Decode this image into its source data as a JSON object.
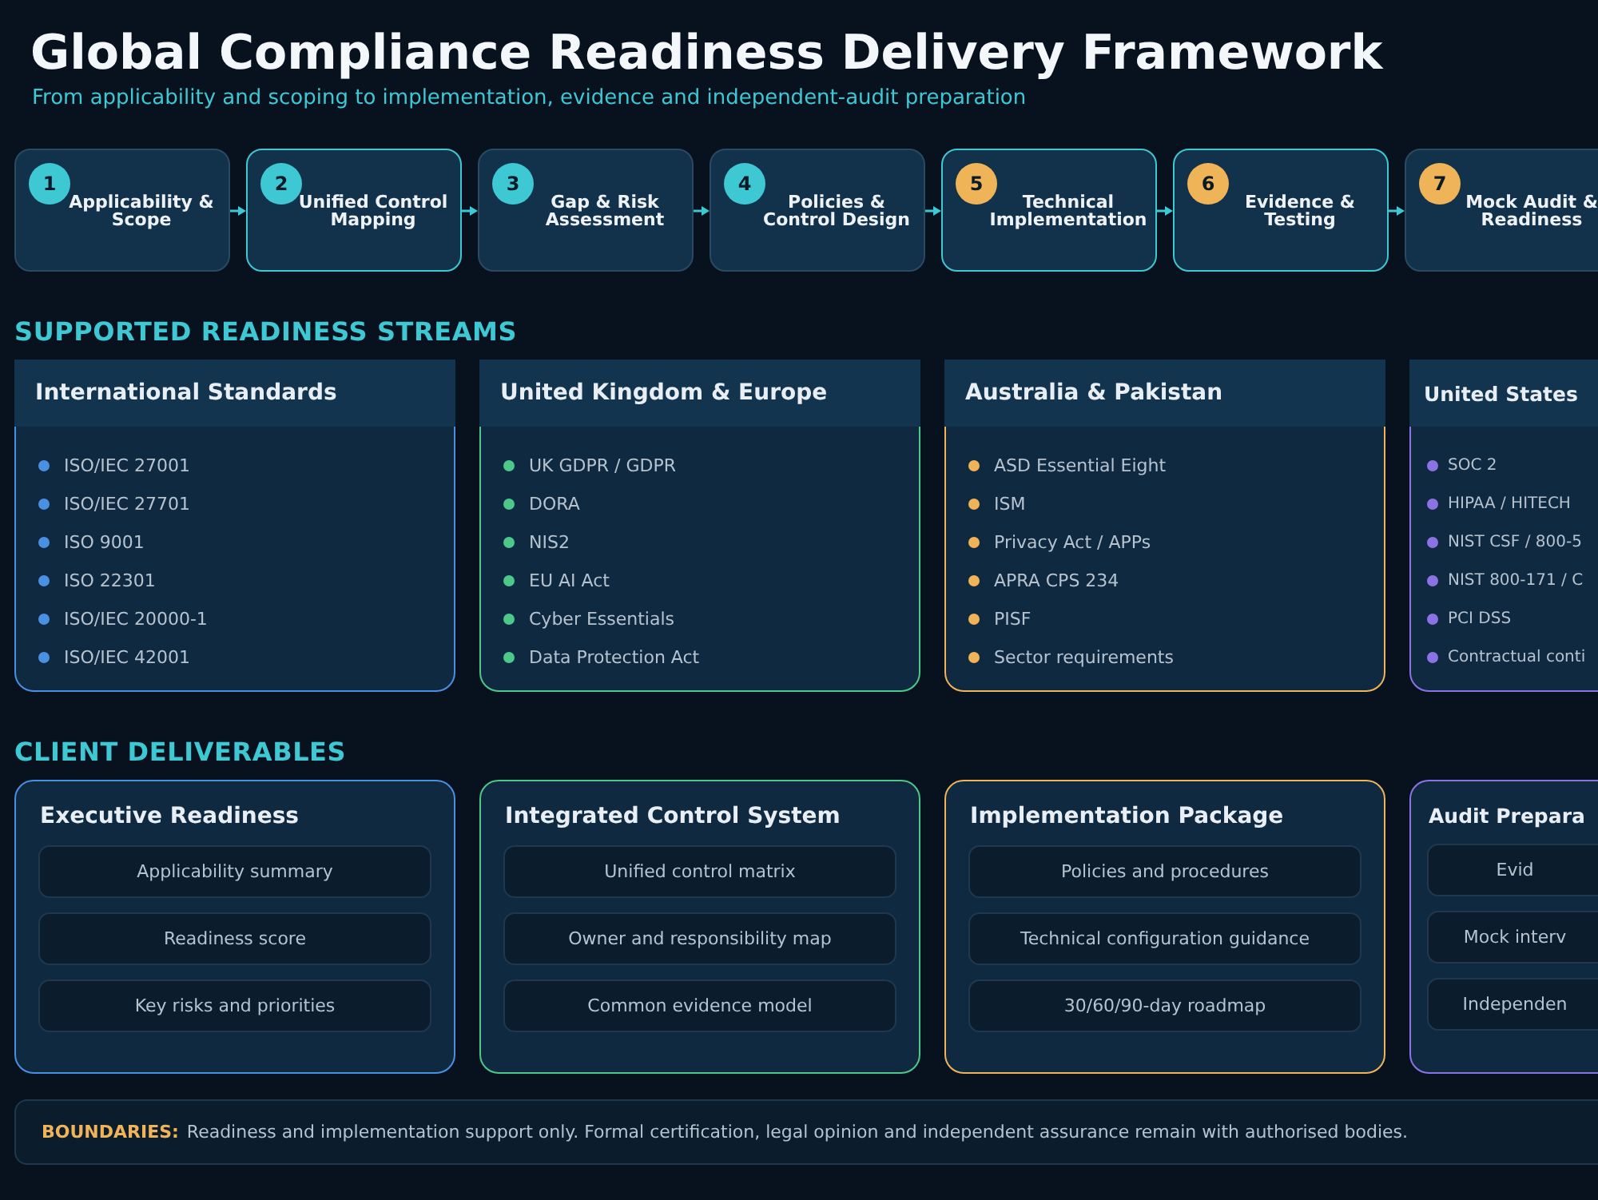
{
  "title": "Global Compliance Readiness Delivery Framework",
  "subtitle": "From applicability and scoping to implementation, evidence and independent-audit preparation",
  "steps": [
    {
      "number": "1",
      "label": "Applicability & Scope",
      "highlighted": false,
      "color": "#3ec8d4"
    },
    {
      "number": "2",
      "label": "Unified Control Mapping",
      "highlighted": true,
      "color": "#3ec8d4"
    },
    {
      "number": "3",
      "label": "Gap & Risk Assessment",
      "highlighted": false,
      "color": "#3ec8d4"
    },
    {
      "number": "4",
      "label": "Policies & Control Design",
      "highlighted": false,
      "color": "#3ec8d4"
    },
    {
      "number": "5",
      "label": "Technical Implementation",
      "highlighted": true,
      "color": "#f0b458"
    },
    {
      "number": "6",
      "label": "Evidence & Testing",
      "highlighted": true,
      "color": "#f0b458"
    },
    {
      "number": "7",
      "label": "Mock Audit & Readiness",
      "highlighted": false,
      "color": "#f0b458"
    }
  ],
  "streams_heading": "SUPPORTED READINESS STREAMS",
  "streams": [
    {
      "title": "International Standards",
      "color": "#4a90e2",
      "items": [
        "ISO/IEC 27001",
        "ISO/IEC 27701",
        "ISO 9001",
        "ISO 22301",
        "ISO/IEC 20000-1",
        "ISO/IEC 42001"
      ]
    },
    {
      "title": "United Kingdom & Europe",
      "color": "#4cc98a",
      "items": [
        "UK GDPR / GDPR",
        "DORA",
        "NIS2",
        "EU AI Act",
        "Cyber Essentials",
        "Data Protection Act"
      ]
    },
    {
      "title": "Australia & Pakistan",
      "color": "#f0b458",
      "items": [
        "ASD Essential Eight",
        "ISM",
        "Privacy Act / APPs",
        "APRA CPS 234",
        "PISF",
        "Sector requirements"
      ]
    },
    {
      "title": "United States",
      "color": "#8b73e6",
      "items": [
        "SOC 2",
        "HIPAA / HITECH",
        "NIST CSF / 800-5",
        "NIST 800-171 / C",
        "PCI DSS",
        "Contractual conti"
      ]
    }
  ],
  "deliverables_heading": "CLIENT DELIVERABLES",
  "deliverables": [
    {
      "title": "Executive Readiness",
      "color": "#4a90e2",
      "items": [
        "Applicability summary",
        "Readiness score",
        "Key risks and priorities"
      ]
    },
    {
      "title": "Integrated Control System",
      "color": "#4cc98a",
      "items": [
        "Unified control matrix",
        "Owner and responsibility map",
        "Common evidence model"
      ]
    },
    {
      "title": "Implementation Package",
      "color": "#f0b458",
      "items": [
        "Policies and procedures",
        "Technical configuration guidance",
        "30/60/90-day roadmap"
      ]
    },
    {
      "title": "Audit Prepara",
      "color": "#8b73e6",
      "items": [
        "Evid",
        "Mock interv",
        "Independen"
      ]
    }
  ],
  "boundaries": {
    "label": "BOUNDARIES:",
    "text": "Readiness and implementation support only. Formal certification, legal opinion and independent assurance remain with authorised bodies."
  }
}
